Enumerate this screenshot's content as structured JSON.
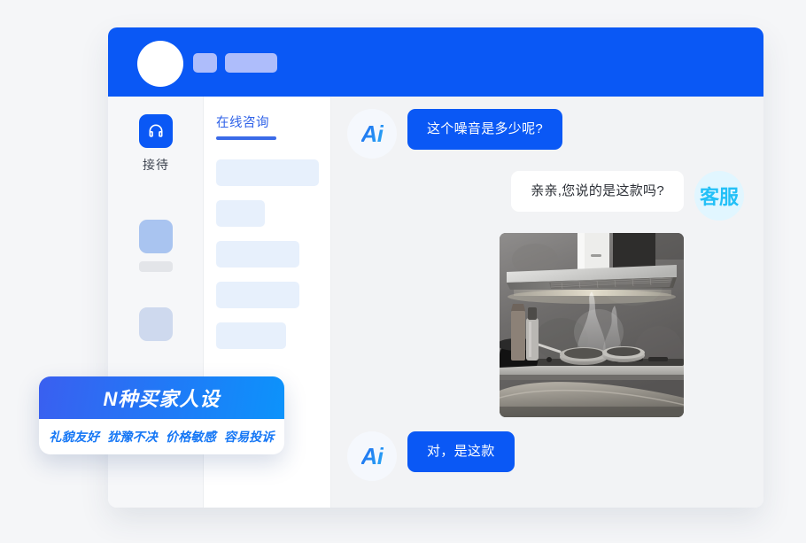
{
  "page": {
    "background_color": "#f5f6f8"
  },
  "window": {
    "header": {
      "accent_color": "#0a58f5",
      "avatar_icon": "avatar-circle-placeholder",
      "chip_small": "",
      "chip_large": ""
    },
    "left_rail": {
      "items": [
        {
          "icon": "headset-icon",
          "label": "接待",
          "active": true
        },
        {
          "icon": "placeholder-icon",
          "label": "",
          "active": false
        },
        {
          "icon": "placeholder-icon",
          "label": "",
          "active": false
        }
      ]
    },
    "conversation_column": {
      "tab_label": "在线咨询",
      "placeholders": [
        {
          "width": 116,
          "height": 30
        },
        {
          "width": 55,
          "height": 30
        },
        {
          "width": 94,
          "height": 30
        },
        {
          "width": 94,
          "height": 30
        },
        {
          "width": 79,
          "height": 30
        }
      ]
    },
    "chat": {
      "messages": [
        {
          "id": "msg-1",
          "side": "left",
          "sender": "ai",
          "avatar_text": "Ai",
          "text": "这个噪音是多少呢?"
        },
        {
          "id": "msg-2",
          "side": "right",
          "sender": "agent",
          "avatar_text": "客服",
          "text": "亲亲,您说的是这款吗?"
        },
        {
          "id": "msg-3",
          "side": "right",
          "sender": "agent",
          "type": "image",
          "image_alt": "kitchen-range-hood-photo"
        },
        {
          "id": "msg-4",
          "side": "left",
          "sender": "ai",
          "avatar_text": "Ai",
          "text": "对，是这款"
        }
      ]
    }
  },
  "promo_banner": {
    "title": "N种买家人设",
    "tags": [
      "礼貌友好",
      "犹豫不决",
      "价格敏感",
      "容易投诉"
    ],
    "gradient_start": "#3a5ff0",
    "gradient_end": "#0c93fb",
    "tag_color": "#1677f5"
  }
}
